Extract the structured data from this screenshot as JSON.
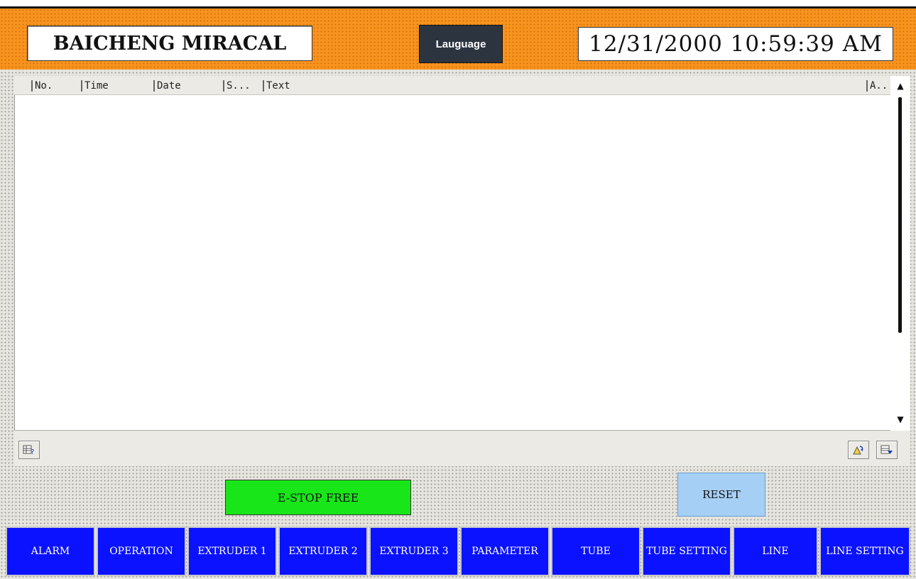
{
  "header": {
    "title": "BAICHENG MIRACAL",
    "language_button": "Lauguage",
    "datetime": "12/31/2000 10:59:39 AM",
    "background_color": "#f7931e"
  },
  "alarm_view": {
    "columns": [
      "No.",
      "Time",
      "Date",
      "S...",
      "Text",
      "A.."
    ],
    "rows": [],
    "icons": [
      "alarm-help-icon",
      "acknowledge-alarm-icon",
      "alarm-filter-icon"
    ]
  },
  "controls": {
    "estop_label": "E-STOP FREE",
    "estop_color": "#19e619",
    "reset_label": "RESET",
    "reset_color": "#a6cff5"
  },
  "nav": {
    "items": [
      "ALARM",
      "OPERATION",
      "EXTRUDER 1",
      "EXTRUDER 2",
      "EXTRUDER 3",
      "PARAMETER",
      "TUBE",
      "TUBE SETTING",
      "LINE",
      "LINE SETTING"
    ],
    "color": "#0a12ff"
  }
}
